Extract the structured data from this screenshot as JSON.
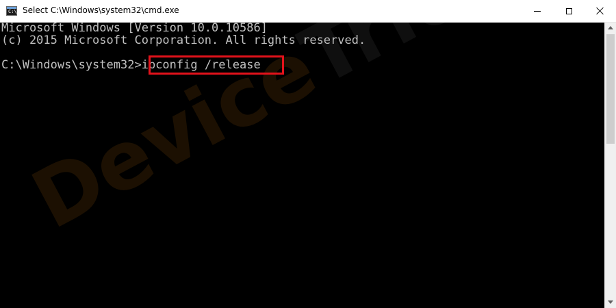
{
  "window": {
    "title": "Select C:\\Windows\\system32\\cmd.exe",
    "icon": "cmd-icon",
    "icon_text": "C:\\"
  },
  "controls": {
    "minimize": "minimize-icon",
    "maximize": "maximize-icon",
    "close": "close-icon"
  },
  "console": {
    "lines": [
      "Microsoft Windows [Version 10.0.10586]",
      "(c) 2015 Microsoft Corporation. All rights reserved.",
      "",
      "C:\\Windows\\system32>"
    ],
    "command": "ipconfig /release"
  },
  "watermark": {
    "part1": "Device",
    "part2": "Tricks"
  },
  "colors": {
    "console_bg": "#000000",
    "console_text": "#c0c0c0",
    "highlight": "#e3121b"
  }
}
